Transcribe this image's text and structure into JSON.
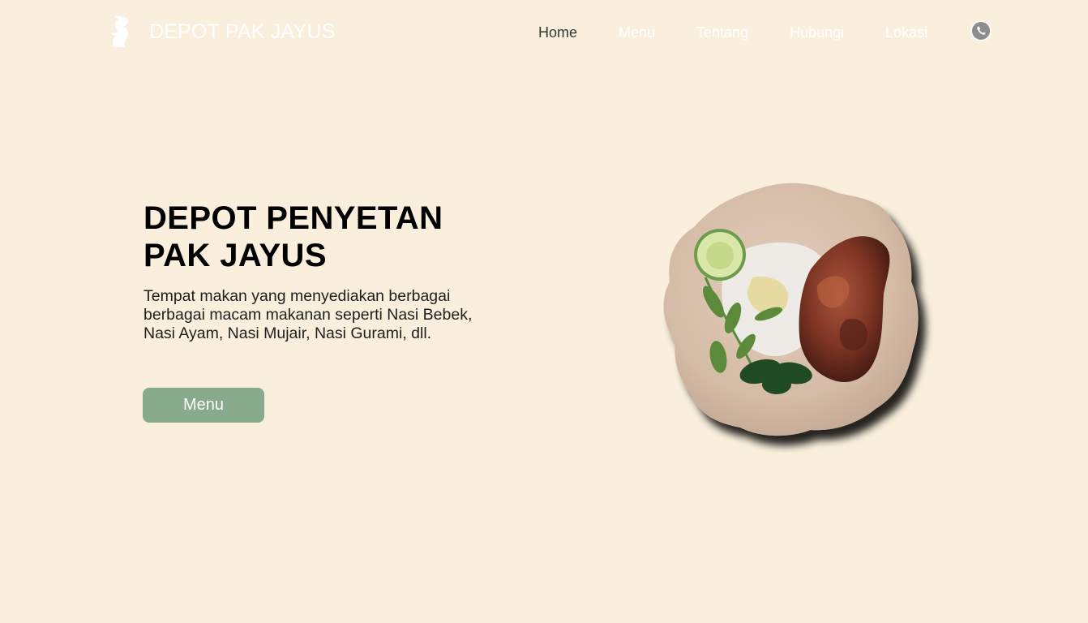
{
  "header": {
    "brand_name": "DEPOT PAK JAYUS",
    "logo_icon": "chef-silhouette-icon",
    "nav": [
      {
        "label": "Home",
        "active": true
      },
      {
        "label": "Menu",
        "active": false
      },
      {
        "label": "Tentang",
        "active": false
      },
      {
        "label": "Hubungi",
        "active": false
      },
      {
        "label": "Lokasi",
        "active": false
      }
    ],
    "contact_icon": "whatsapp-icon"
  },
  "hero": {
    "title": "DEPOT PENYETAN PAK JAYUS",
    "description": "Tempat makan yang menyediakan berbagai berbagai macam makanan seperti Nasi Bebek, Nasi Ayam, Nasi Mujair, Nasi Gurami, dll.",
    "button_label": "Menu",
    "image": "fried-duck-rice-plate"
  },
  "colors": {
    "background": "#f9efdc",
    "accent": "#88ab8e",
    "nav_active": "#2e3a30",
    "nav_inactive": "#ffffff"
  }
}
